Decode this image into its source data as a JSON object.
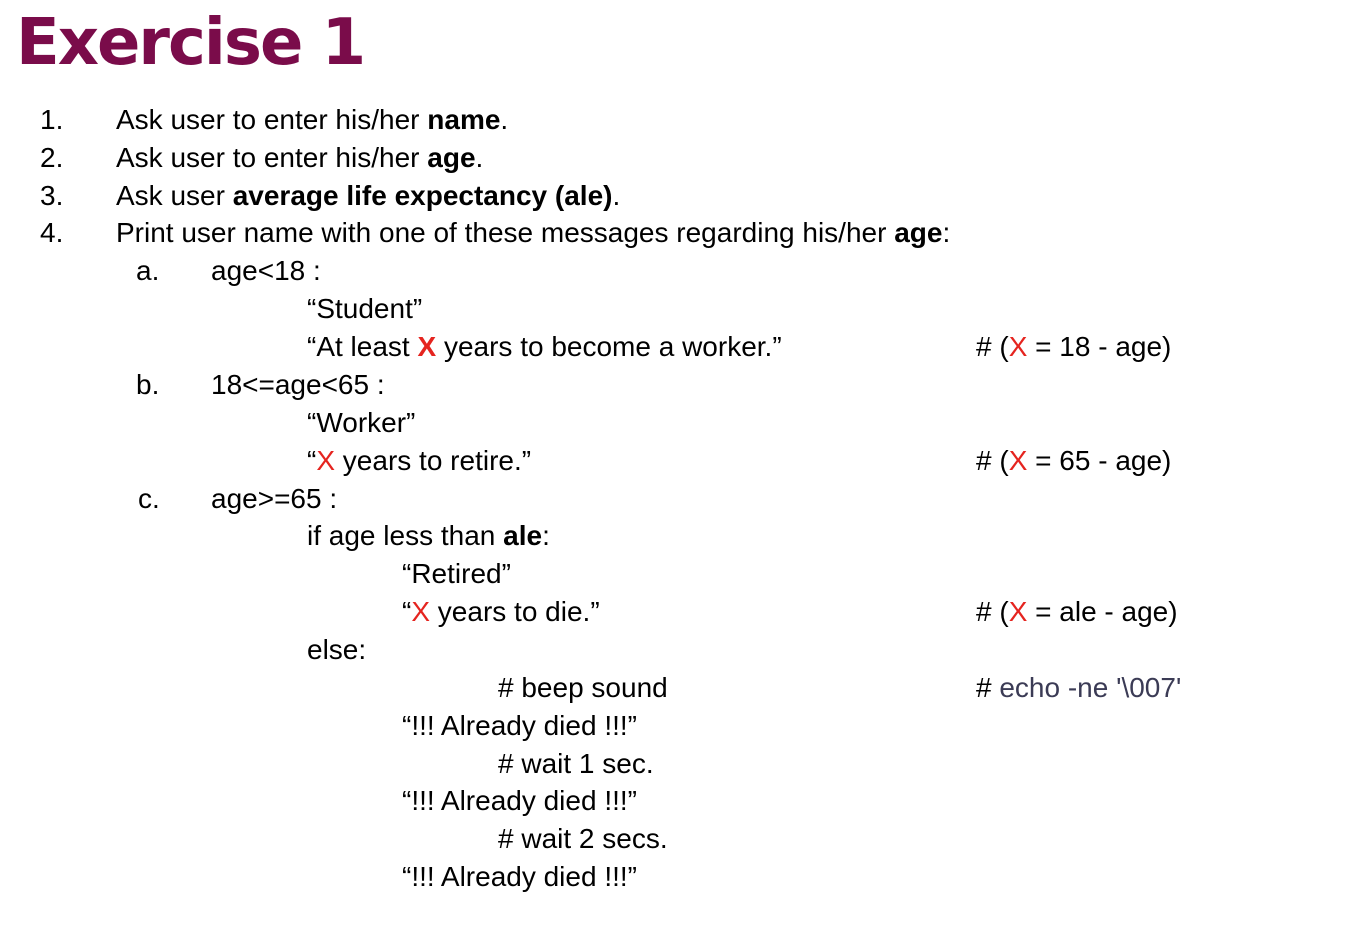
{
  "title": "Exercise 1",
  "items": [
    {
      "marker": "1.",
      "pre": "Ask user to enter his/her ",
      "bold": "name",
      "post": "."
    },
    {
      "marker": "2.",
      "pre": "Ask user to enter his/her ",
      "bold": "age",
      "post": "."
    },
    {
      "marker": "3.",
      "pre": "Ask user ",
      "bold": "average life expectancy (ale)",
      "post": "."
    },
    {
      "marker": "4.",
      "pre": "Print user name with one of these messages regarding his/her ",
      "bold": "age",
      "post": ":"
    }
  ],
  "cases": {
    "a": {
      "marker": "a.",
      "condition": "age<18 :",
      "msg1": "“Student”",
      "msg2_pre": "“At least ",
      "msg2_x": "X",
      "msg2_post": " years to become a worker.”",
      "comment_pre": "# (",
      "comment_x": "X",
      "comment_post": " = 18 - age)"
    },
    "b": {
      "marker": "b.",
      "condition": "18<=age<65 :",
      "msg1": "“Worker”",
      "msg2_pre": "“",
      "msg2_x": "X",
      "msg2_post": " years to retire.”",
      "comment_pre": "# (",
      "comment_x": "X",
      "comment_post": " = 65 - age)"
    },
    "c": {
      "marker": "c.",
      "condition": "age>=65 :",
      "if_pre": "if age less than ",
      "if_bold": "ale",
      "if_post": ":",
      "retired": "“Retired”",
      "die_pre": "“",
      "die_x": "X",
      "die_post": " years to die.”",
      "die_comment_pre": "# (",
      "die_comment_x": "X",
      "die_comment_post": " = ale - age)",
      "else": "else:",
      "beep": "# beep sound",
      "beep_comment_hash": "# ",
      "beep_comment_cmd": "echo -ne '\\007'",
      "died1": "“!!! Already died !!!”",
      "wait1": "# wait 1 sec.",
      "died2": "“!!! Already died !!!”",
      "wait2": "# wait 2 secs.",
      "died3": "“!!! Already died !!!”"
    }
  },
  "colors": {
    "title": "#7a0c4a",
    "highlight": "#e5241f",
    "command": "#3b3b55"
  }
}
